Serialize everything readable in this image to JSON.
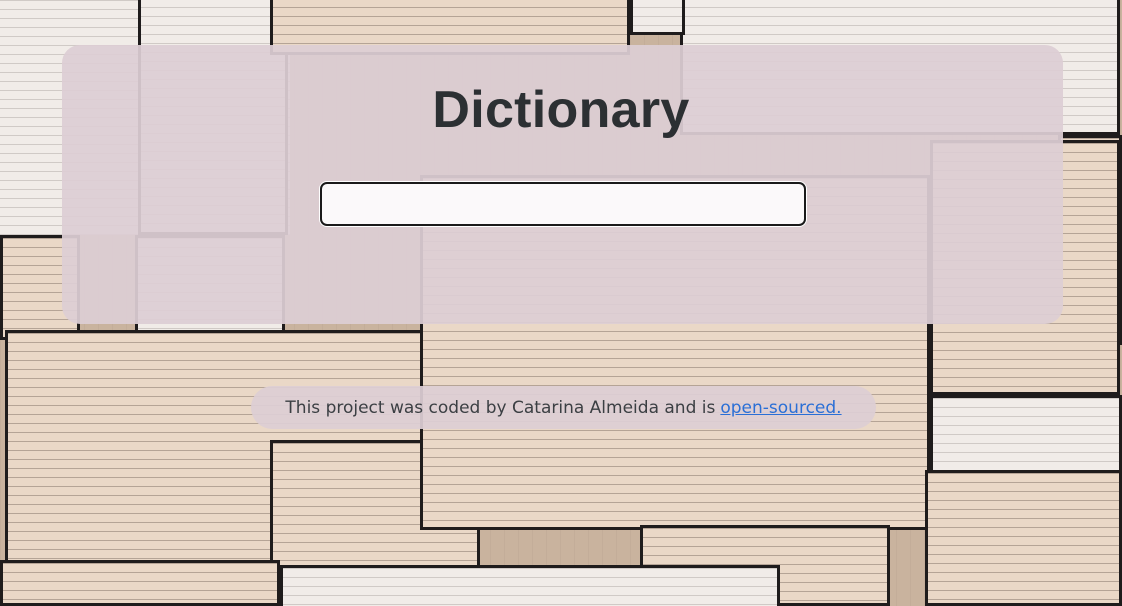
{
  "app": {
    "title": "Dictionary"
  },
  "search": {
    "value": "",
    "placeholder": ""
  },
  "footer": {
    "text": "This project was coded by Catarina Almeida and is",
    "link_label": "open-sourced."
  },
  "colors": {
    "card_background": "#ddced4",
    "title_text": "#2c3033",
    "link": "#2a6fd6"
  }
}
